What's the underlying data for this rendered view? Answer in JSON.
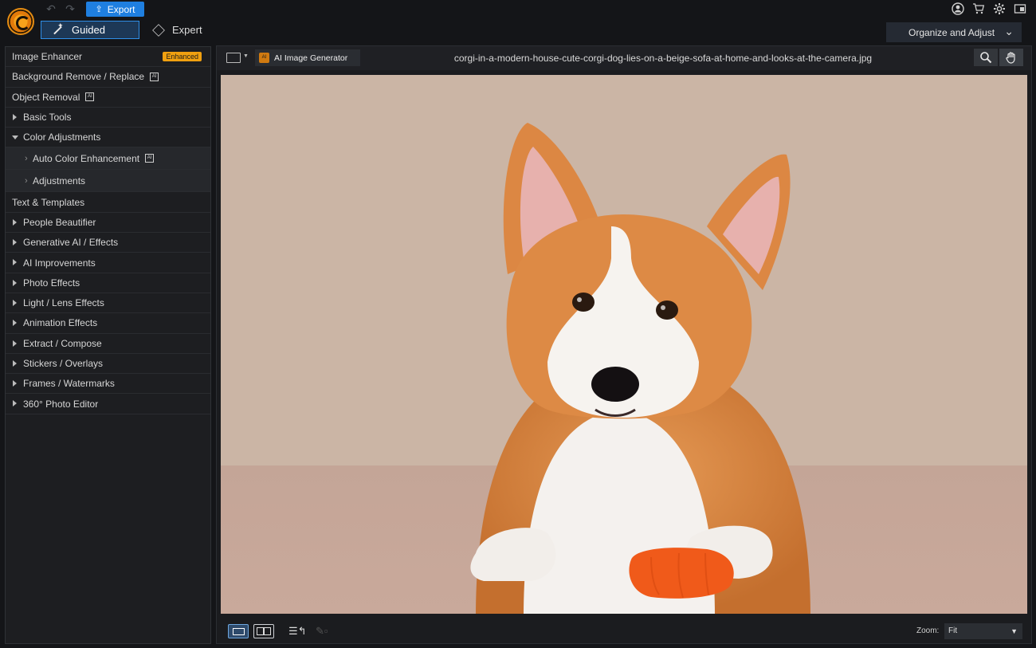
{
  "topbar": {
    "export_label": "Export",
    "mode_guided": "Guided",
    "mode_expert": "Expert",
    "organize_label": "Organize and Adjust",
    "icons": [
      "undo-icon",
      "redo-icon",
      "account-icon",
      "cart-icon",
      "gear-icon",
      "window-icon"
    ]
  },
  "sidebar": {
    "items": [
      {
        "label": "Image Enhancer",
        "badge": "Enhanced"
      },
      {
        "label": "Background Remove / Replace",
        "ai": "AI"
      },
      {
        "label": "Object Removal",
        "ai": "AI"
      },
      {
        "label": "Basic Tools"
      },
      {
        "label": "Color Adjustments"
      },
      {
        "label": "Auto Color Enhancement",
        "ai": "AI"
      },
      {
        "label": "Adjustments"
      },
      {
        "label": "Text & Templates"
      },
      {
        "label": "People Beautifier"
      },
      {
        "label": "Generative AI / Effects"
      },
      {
        "label": "AI Improvements"
      },
      {
        "label": "Photo Effects"
      },
      {
        "label": "Light / Lens Effects"
      },
      {
        "label": "Animation Effects"
      },
      {
        "label": "Extract / Compose"
      },
      {
        "label": "Stickers / Overlays"
      },
      {
        "label": "Frames / Watermarks"
      },
      {
        "label": "360° Photo Editor"
      }
    ]
  },
  "workarea": {
    "ai_generator_label": "AI Image Generator",
    "ai_icon_text": "AI",
    "filename": "corgi-in-a-modern-house-cute-corgi-dog-lies-on-a-beige-sofa-at-home-and-looks-at-the-camera.jpg",
    "zoom_label": "Zoom:",
    "zoom_value": "Fit"
  },
  "colors": {
    "accent": "#1f7fe0",
    "badge": "#f0a010",
    "background": "#141518"
  }
}
